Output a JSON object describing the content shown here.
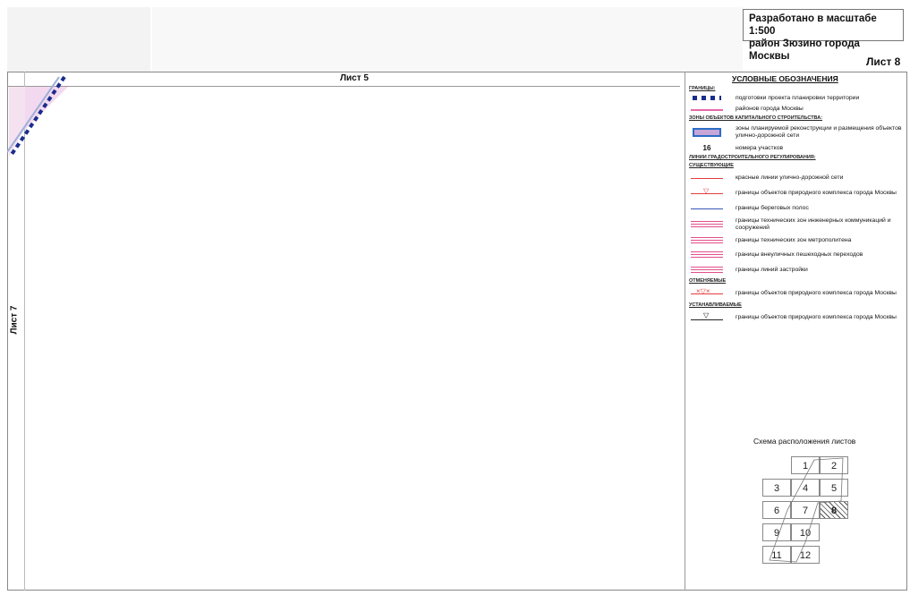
{
  "header": {
    "title_line1": "Разработано в масштабе 1:500",
    "title_line2": "район Зюзино города Москвы",
    "sheet_number": "Лист 8"
  },
  "map": {
    "top_neighbor": "Лист 5",
    "left_neighbor": "Лист 7"
  },
  "legend": {
    "heading": "УСЛОВНЫЕ ОБОЗНАЧЕНИЯ",
    "cat_borders": "ГРАНИЦЫ:",
    "item_project": "подготовки проекта планировки территории",
    "item_districts": "районов города Москвы",
    "cat_zones": "ЗОНЫ ОБЪЕКТОВ КАПИТАЛЬНОГО СТРОИТЕЛЬСТВА:",
    "item_zones": "зоны планируемой реконструкции и размещения объектов улично-дорожной сети",
    "sym_number": "16",
    "item_numbers": "номера участков",
    "cat_lines": "ЛИНИИ ГРАДОСТРОИТЕЛЬНОГО РЕГУЛИРОВАНИЯ:",
    "cat_existing": "СУЩЕСТВУЮЩИЕ",
    "item_red": "красные линии улично-дорожной сети",
    "item_natural": "границы объектов природного комплекса города Москвы",
    "item_coast": "границы береговых полос",
    "item_tech": "границы технических зон инженерных коммуникаций и сооружений",
    "item_metro": "границы технических зон метрополитена",
    "item_passages": "границы внеуличных пешеходных переходов",
    "item_building": "границы линий застройки",
    "cat_cancelled": "ОТМЕНЯЕМЫЕ",
    "item_natural_cancel": "границы объектов природного комплекса города Москвы",
    "cat_established": "УСТАНАВЛИВАЕМЫЕ",
    "item_natural_new": "границы объектов природного комплекса города Москвы"
  },
  "scheme": {
    "title": "Схема расположения листов",
    "cells": [
      "1",
      "2",
      "3",
      "4",
      "5",
      "6",
      "7",
      "8",
      "9",
      "10",
      "11",
      "12"
    ]
  }
}
